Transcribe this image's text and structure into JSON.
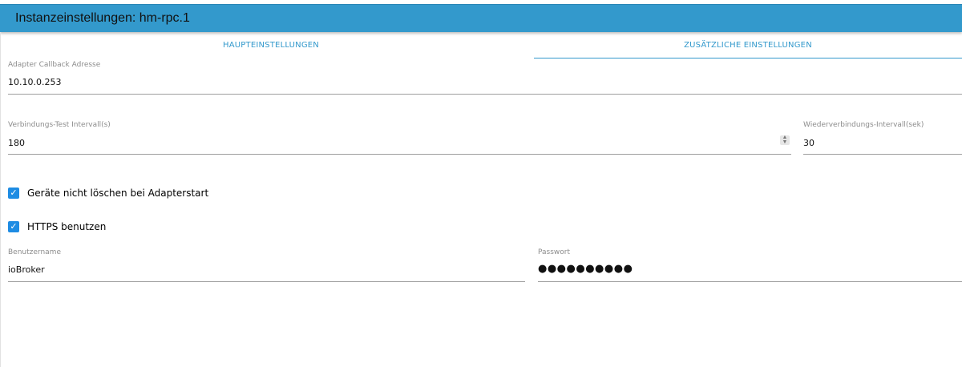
{
  "header": {
    "title": "Instanzeinstellungen: hm-rpc.1"
  },
  "tabs": [
    {
      "label": "HAUPTEINSTELLUNGEN",
      "active": false
    },
    {
      "label": "ZUSÄTZLICHE EINSTELLUNGEN",
      "active": true
    }
  ],
  "fields": {
    "callback": {
      "label": "Adapter Callback Adresse",
      "value": "10.10.0.253"
    },
    "interval": {
      "label": "Verbindungs-Test Intervall(s)",
      "value": "180"
    },
    "reconnect": {
      "label": "Wiederverbindungs-Intervall(sek)",
      "value": "30"
    },
    "username": {
      "label": "Benutzername",
      "value": "ioBroker"
    },
    "password": {
      "label": "Passwort",
      "value": "●●●●●●●●●●"
    }
  },
  "checkboxes": [
    {
      "label": "Geräte nicht löschen bei Adapterstart",
      "checked": true
    },
    {
      "label": "HTTPS benutzen",
      "checked": true
    }
  ],
  "colors": {
    "accent": "#3399cc",
    "checkbox": "#1e8ce3"
  }
}
